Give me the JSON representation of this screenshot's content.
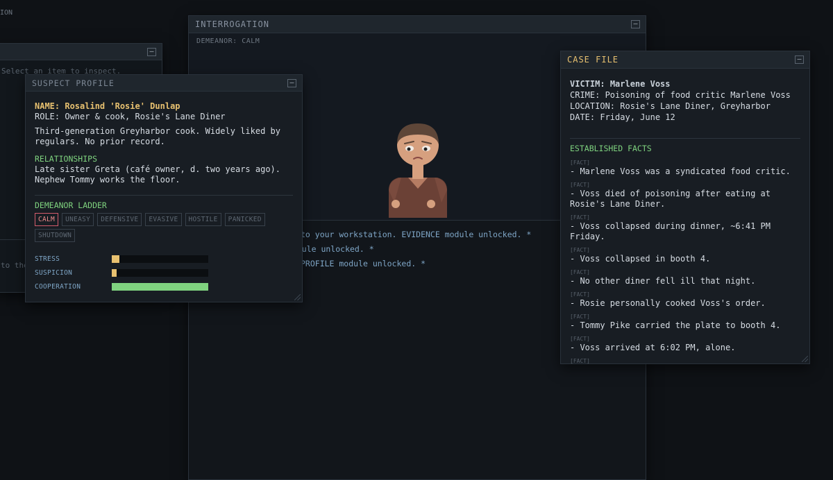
{
  "corner_label": "ION",
  "inspect_window": {
    "hint": "Select an item to inspect.",
    "lower_text": "to the"
  },
  "interrogation": {
    "title": "INTERROGATION",
    "demeanor": "DEMEANOR: CALM",
    "log": [
      "to your workstation. EVIDENCE module unlocked. *",
      "module unlocked. *",
      "PROFILE module unlocked. *"
    ]
  },
  "suspect_profile": {
    "title": "SUSPECT PROFILE",
    "name": "NAME: Rosalind 'Rosie' Dunlap",
    "role": "ROLE: Owner & cook, Rosie's Lane Diner",
    "bio": "Third-generation Greyharbor cook. Widely liked by regulars. No prior record.",
    "relationships_heading": "RELATIONSHIPS",
    "relationships": "Late sister Greta (café owner, d. two years ago). Nephew Tommy works the floor.",
    "ladder_heading": "DEMEANOR LADDER",
    "ladder": [
      "CALM",
      "UNEASY",
      "DEFENSIVE",
      "EVASIVE",
      "HOSTILE",
      "PANICKED",
      "SHUTDOWN"
    ],
    "active_level": "CALM",
    "meters": [
      {
        "label": "STRESS",
        "value": 0.08,
        "color": "#e8c170"
      },
      {
        "label": "SUSPICION",
        "value": 0.05,
        "color": "#e8c170"
      },
      {
        "label": "COOPERATION",
        "value": 1.0,
        "color": "#7fd37f"
      }
    ]
  },
  "case_file": {
    "title": "CASE FILE",
    "victim_label": "VICTIM:",
    "victim": "Marlene Voss",
    "crime": "CRIME: Poisoning of food critic Marlene Voss",
    "location": "LOCATION: Rosie's Lane Diner, Greyharbor",
    "date": "DATE: Friday, June 12",
    "facts_heading": "ESTABLISHED FACTS",
    "fact_tag": "[FACT]",
    "facts": [
      "- Marlene Voss was a syndicated food critic.",
      "- Voss died of poisoning after eating at Rosie's Lane Diner.",
      "- Voss collapsed during dinner, ~6:41 PM Friday.",
      "- Voss collapsed in booth 4.",
      "- No other diner fell ill that night.",
      "- Rosie personally cooked Voss's order.",
      "- Tommy Pike carried the plate to booth 4.",
      "- Voss arrived at 6:02 PM, alone."
    ],
    "trailing_tag": "[FACT]"
  },
  "colors": {
    "accent_gold": "#e8c170",
    "accent_green": "#7fd37f",
    "alert_red": "#d45c6c",
    "log_blue": "#7fa6c7"
  }
}
